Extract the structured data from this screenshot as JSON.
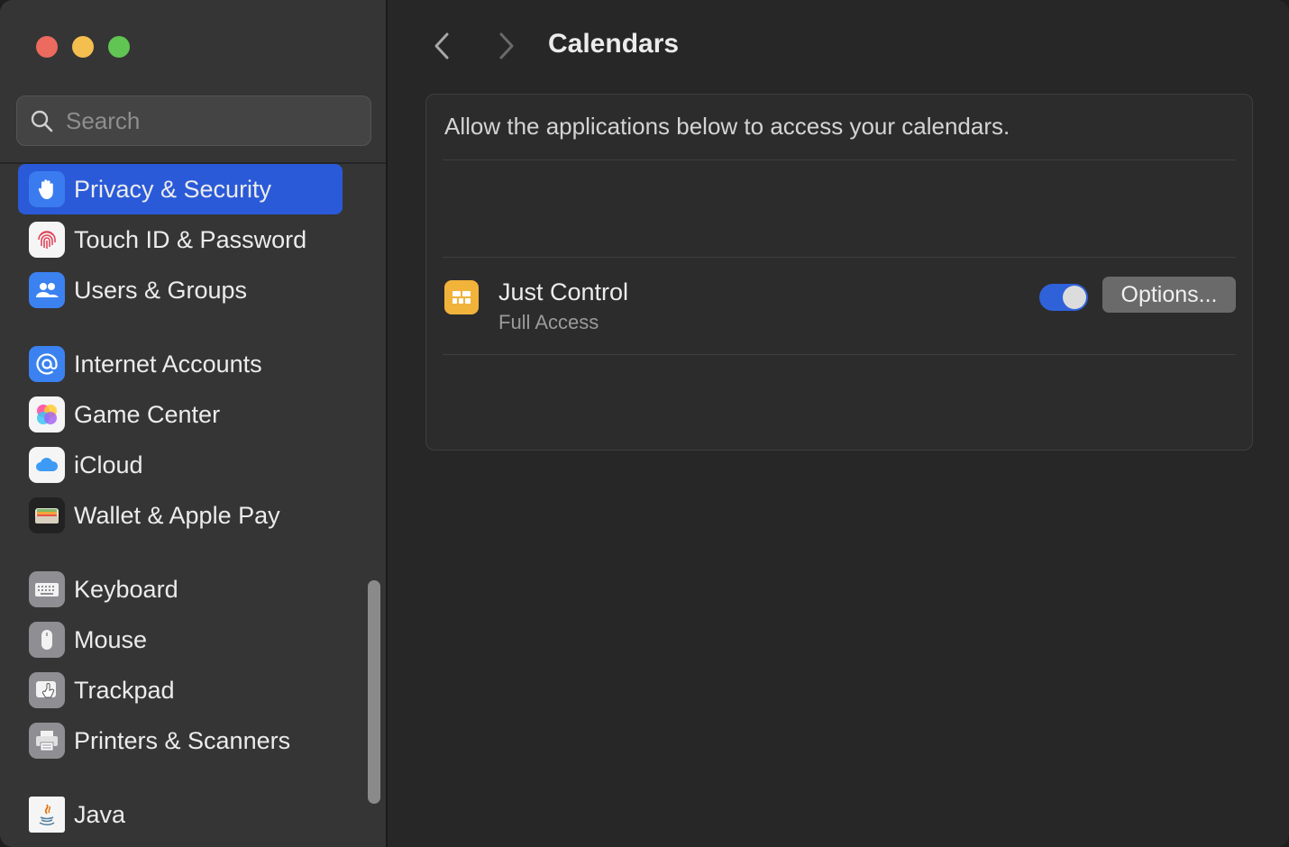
{
  "window": {
    "title": "Calendars"
  },
  "search": {
    "placeholder": "Search"
  },
  "sidebar": {
    "items": [
      {
        "label": "Privacy & Security",
        "icon": "hand-raised-icon",
        "active": true
      },
      {
        "label": "Touch ID & Password",
        "icon": "fingerprint-icon"
      },
      {
        "label": "Users & Groups",
        "icon": "users-icon"
      },
      {
        "label": "Internet Accounts",
        "icon": "at-sign-icon"
      },
      {
        "label": "Game Center",
        "icon": "game-center-icon"
      },
      {
        "label": "iCloud",
        "icon": "cloud-icon"
      },
      {
        "label": "Wallet & Apple Pay",
        "icon": "wallet-icon"
      },
      {
        "label": "Keyboard",
        "icon": "keyboard-icon"
      },
      {
        "label": "Mouse",
        "icon": "mouse-icon"
      },
      {
        "label": "Trackpad",
        "icon": "trackpad-icon"
      },
      {
        "label": "Printers & Scanners",
        "icon": "printer-icon"
      },
      {
        "label": "Java",
        "icon": "java-icon"
      }
    ]
  },
  "main": {
    "description": "Allow the applications below to access your calendars.",
    "apps": [
      {
        "name": "Just Control",
        "status": "Full Access",
        "enabled": true,
        "options_label": "Options..."
      }
    ]
  },
  "colors": {
    "accent": "#2a5ad8",
    "toggle_on": "#2f62d9",
    "app_icon": "#f1b33a"
  }
}
